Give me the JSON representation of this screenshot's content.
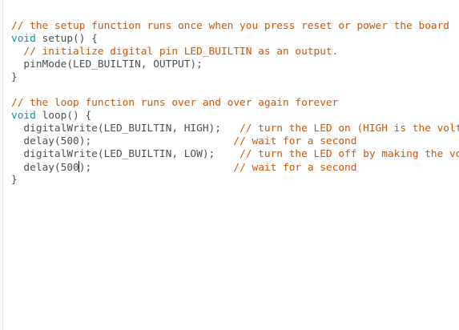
{
  "editor": {
    "lines": [
      {
        "parts": [
          {
            "t": "// the setup function runs once when you press reset or power the board",
            "c": "cm-orange"
          }
        ]
      },
      {
        "parts": [
          {
            "t": "void",
            "c": "kw"
          },
          {
            "t": " setup() {",
            "c": "fn"
          }
        ]
      },
      {
        "parts": [
          {
            "t": "  // initialize digital pin LED_BUILTIN as an output.",
            "c": "cm-orange"
          }
        ]
      },
      {
        "parts": [
          {
            "t": "  pinMode(LED_BUILTIN, OUTPUT);",
            "c": "fn"
          }
        ]
      },
      {
        "parts": [
          {
            "t": "}",
            "c": "fn"
          }
        ]
      },
      {
        "parts": [
          {
            "t": "",
            "c": "fn"
          }
        ]
      },
      {
        "parts": [
          {
            "t": "// the loop function runs over and over again forever",
            "c": "cm-orange"
          }
        ]
      },
      {
        "parts": [
          {
            "t": "void",
            "c": "kw"
          },
          {
            "t": " loop() {",
            "c": "fn"
          }
        ]
      },
      {
        "parts": [
          {
            "t": "  digitalWrite(LED_BUILTIN, HIGH);   ",
            "c": "fn"
          },
          {
            "t": "// turn the LED on (HIGH is the voltage level)",
            "c": "cm-orange"
          }
        ]
      },
      {
        "parts": [
          {
            "t": "  delay(500);                       ",
            "c": "fn"
          },
          {
            "t": "// wait for a second",
            "c": "cm-orange"
          }
        ]
      },
      {
        "parts": [
          {
            "t": "  digitalWrite(LED_BUILTIN, LOW);    ",
            "c": "fn"
          },
          {
            "t": "// turn the LED off by making the voltage LOW",
            "c": "cm-orange"
          }
        ]
      },
      {
        "parts": [
          {
            "t": "  delay(500",
            "c": "fn"
          },
          {
            "t": "|caret|",
            "c": "caret"
          },
          {
            "t": ");                       ",
            "c": "fn"
          },
          {
            "t": "// wait for a second",
            "c": "cm-orange"
          }
        ]
      },
      {
        "parts": [
          {
            "t": "}",
            "c": "fn"
          }
        ]
      }
    ]
  }
}
